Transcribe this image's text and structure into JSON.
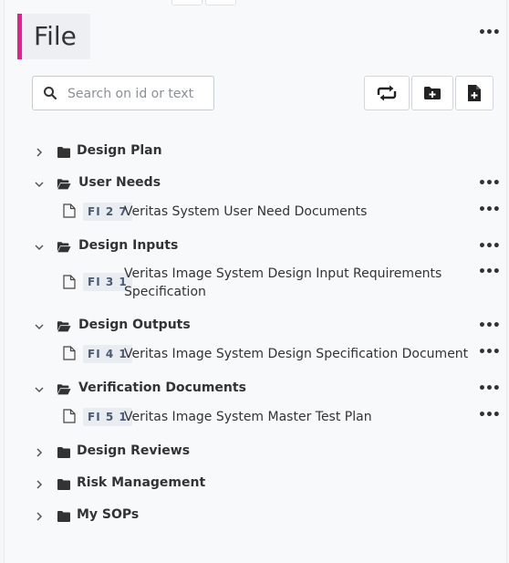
{
  "header": {
    "title": "File"
  },
  "search": {
    "placeholder": "Search on id or text",
    "value": ""
  },
  "toolbar": {
    "icons": [
      "sync-icon",
      "add-folder-icon",
      "add-file-icon"
    ]
  },
  "colors": {
    "accent": "#e91e8c",
    "badge_bg": "#e9ecf0",
    "badge_text": "#4a5a72"
  },
  "tree": [
    {
      "label": "Design Plan",
      "expanded": false,
      "children": []
    },
    {
      "label": "User Needs",
      "expanded": true,
      "children": [
        {
          "id": "FI27",
          "id_display": "FI 2 7",
          "title": "Veritas System User Need Documents"
        }
      ]
    },
    {
      "label": "Design Inputs",
      "expanded": true,
      "children": [
        {
          "id": "FI31",
          "id_display": "FI 3 1",
          "title_line1": "Veritas Image System Design Input Requirements",
          "title_line2": "Specification"
        }
      ]
    },
    {
      "label": "Design Outputs",
      "expanded": true,
      "children": [
        {
          "id": "FI41",
          "id_display": "FI 4 1",
          "title": "Veritas Image System Design Specification Document"
        }
      ]
    },
    {
      "label": "Verification Documents",
      "expanded": true,
      "children": [
        {
          "id": "FI51",
          "id_display": "FI 5 1",
          "title": "Veritas Image System Master Test Plan"
        }
      ]
    },
    {
      "label": "Design Reviews",
      "expanded": false,
      "children": []
    },
    {
      "label": "Risk Management",
      "expanded": false,
      "children": []
    },
    {
      "label": "My SOPs",
      "expanded": false,
      "children": []
    }
  ]
}
